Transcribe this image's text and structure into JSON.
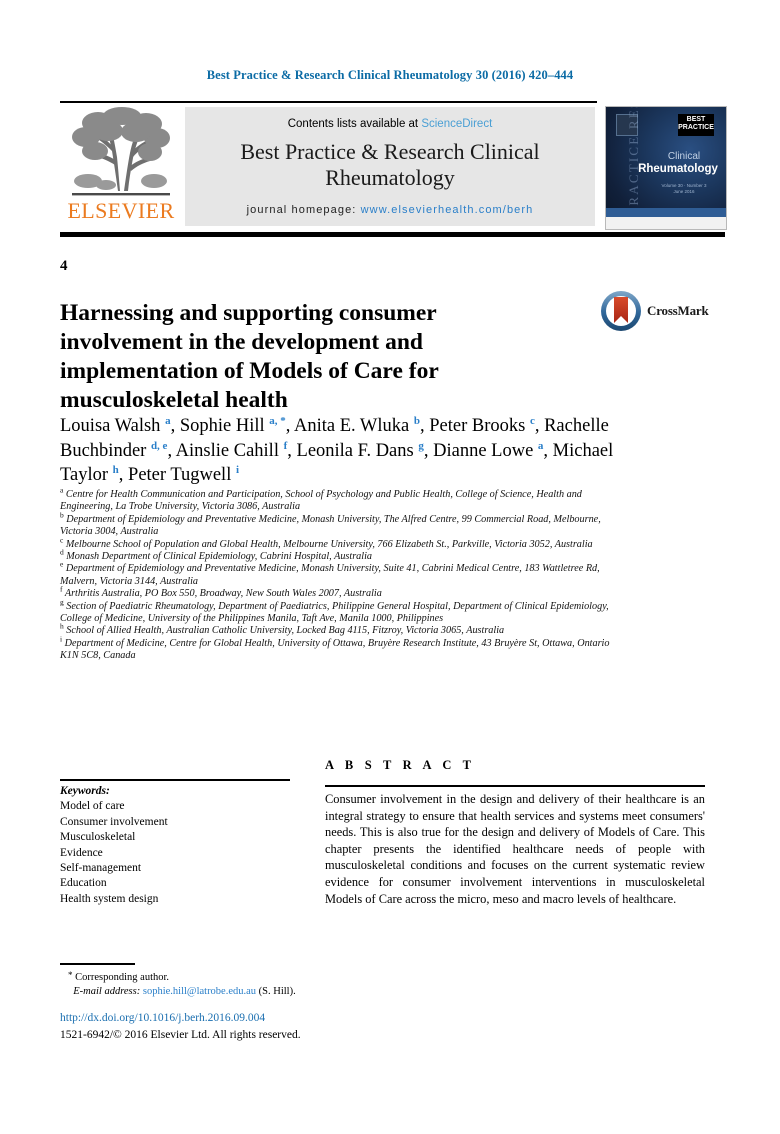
{
  "running_head": "Best Practice & Research Clinical Rheumatology 30 (2016) 420–444",
  "masthead": {
    "contents_prefix": "Contents lists available at ",
    "sciencedirect": "ScienceDirect",
    "journal_title": "Best Practice & Research Clinical Rheumatology",
    "homepage_label": "journal homepage:",
    "homepage_url": "www.elsevierhealth.com/berh",
    "publisher_wordmark": "ELSEVIER",
    "cover": {
      "vertical_text": "PRACTICE RESEARCH",
      "best_box": "BEST PRACTICE",
      "line1": "Clinical",
      "line2": "Rheumatology",
      "sub": "Volume 30 · Number 3\nJune 2016"
    }
  },
  "article": {
    "chapter_number": "4",
    "title": "Harnessing and supporting consumer involvement in the development and implementation of Models of Care for musculoskeletal health",
    "crossmark_label": "CrossMark"
  },
  "authors": [
    {
      "name": "Louisa Walsh",
      "marks": "a"
    },
    {
      "name": "Sophie Hill",
      "marks": "a, *"
    },
    {
      "name": "Anita E. Wluka",
      "marks": "b"
    },
    {
      "name": "Peter Brooks",
      "marks": "c"
    },
    {
      "name": "Rachelle Buchbinder",
      "marks": "d, e"
    },
    {
      "name": "Ainslie Cahill",
      "marks": "f"
    },
    {
      "name": "Leonila F. Dans",
      "marks": "g"
    },
    {
      "name": "Dianne Lowe",
      "marks": "a"
    },
    {
      "name": "Michael Taylor",
      "marks": "h"
    },
    {
      "name": "Peter Tugwell",
      "marks": "i"
    }
  ],
  "affiliations": [
    {
      "mark": "a",
      "text": "Centre for Health Communication and Participation, School of Psychology and Public Health, College of Science, Health and Engineering, La Trobe University, Victoria 3086, Australia"
    },
    {
      "mark": "b",
      "text": "Department of Epidemiology and Preventative Medicine, Monash University, The Alfred Centre, 99 Commercial Road, Melbourne, Victoria 3004, Australia"
    },
    {
      "mark": "c",
      "text": "Melbourne School of Population and Global Health, Melbourne University, 766 Elizabeth St., Parkville, Victoria 3052, Australia"
    },
    {
      "mark": "d",
      "text": "Monash Department of Clinical Epidemiology, Cabrini Hospital, Australia"
    },
    {
      "mark": "e",
      "text": "Department of Epidemiology and Preventative Medicine, Monash University, Suite 41, Cabrini Medical Centre, 183 Wattletree Rd, Malvern, Victoria 3144, Australia"
    },
    {
      "mark": "f",
      "text": "Arthritis Australia, PO Box 550, Broadway, New South Wales 2007, Australia"
    },
    {
      "mark": "g",
      "text": "Section of Paediatric Rheumatology, Department of Paediatrics, Philippine General Hospital, Department of Clinical Epidemiology, College of Medicine, University of the Philippines Manila, Taft Ave, Manila 1000, Philippines"
    },
    {
      "mark": "h",
      "text": "School of Allied Health, Australian Catholic University, Locked Bag 4115, Fitzroy, Victoria 3065, Australia"
    },
    {
      "mark": "i",
      "text": "Department of Medicine, Centre for Global Health, University of Ottawa, Bruyère Research Institute, 43 Bruyère St, Ottawa, Ontario K1N 5C8, Canada"
    }
  ],
  "keywords": {
    "heading": "Keywords:",
    "items": [
      "Model of care",
      "Consumer involvement",
      "Musculoskeletal",
      "Evidence",
      "Self-management",
      "Education",
      "Health system design"
    ]
  },
  "abstract": {
    "heading": "A B S T R A C T",
    "body": "Consumer involvement in the design and delivery of their healthcare is an integral strategy to ensure that health services and systems meet consumers' needs. This is also true for the design and delivery of Models of Care. This chapter presents the identified healthcare needs of people with musculoskeletal conditions and focuses on the current systematic review evidence for consumer involvement interventions in musculoskeletal Models of Care across the micro, meso and macro levels of healthcare."
  },
  "footer": {
    "corresponding_note": "Corresponding author.",
    "email_label": "E-mail address:",
    "email": "sophie.hill@latrobe.edu.au",
    "email_suffix": "(S. Hill).",
    "doi": "http://dx.doi.org/10.1016/j.berh.2016.09.004",
    "copyright": "1521-6942/© 2016 Elsevier Ltd. All rights reserved."
  },
  "colors": {
    "link_blue": "#2a7fc9",
    "header_blue": "#0b6ba5",
    "elsevier_orange": "#eb7b20",
    "masthead_gray": "#e6e6e6"
  }
}
